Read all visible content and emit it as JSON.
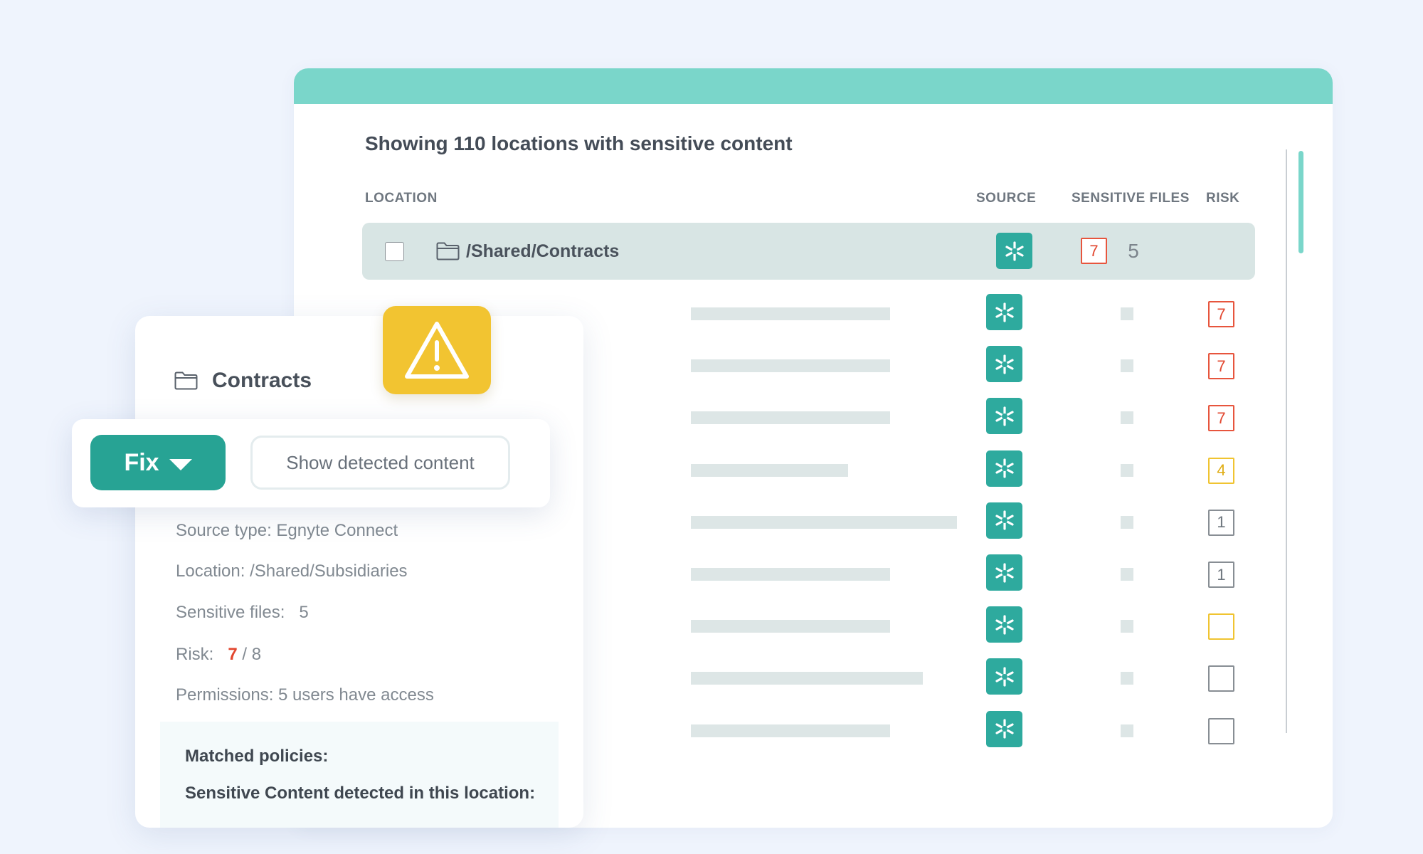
{
  "table": {
    "heading": "Showing 110 locations with sensitive content",
    "columns": {
      "location": "LOCATION",
      "source": "SOURCE",
      "sensitive_files": "SENSITIVE FILES",
      "risk": "RISK"
    },
    "selected_row": {
      "path": "/Shared/Contracts",
      "source_icon": "egnyte-connect-icon",
      "sensitive_files": "5",
      "risk": "7"
    },
    "rows": [
      {
        "risk": "7",
        "risk_level": "high"
      },
      {
        "risk": "7",
        "risk_level": "high"
      },
      {
        "risk": "7",
        "risk_level": "high"
      },
      {
        "risk": "4",
        "risk_level": "medium"
      },
      {
        "risk": "1",
        "risk_level": "low"
      },
      {
        "risk": "1",
        "risk_level": "low"
      },
      {
        "risk": "",
        "risk_level": "medium"
      },
      {
        "risk": "",
        "risk_level": "low"
      },
      {
        "risk": "",
        "risk_level": "low"
      }
    ]
  },
  "detail": {
    "title": "Contracts",
    "fix_label": "Fix",
    "show_content_label": "Show detected content",
    "source_type": "Source type: Egnyte Connect",
    "location": "Location: /Shared/Subsidiaries",
    "sensitive_files_label": "Sensitive files:",
    "sensitive_files_value": "5",
    "risk_label": "Risk:",
    "risk_value": "7",
    "risk_max": "/ 8",
    "permissions": "Permissions: 5 users have access",
    "matched_policies": "Matched policies:",
    "sensitive_content": "Sensitive Content detected in this location:"
  },
  "colors": {
    "accent_teal": "#27a394",
    "topbar_teal": "#7ad6ca",
    "risk_high": "#e2462e",
    "risk_medium": "#f0c431",
    "warning_yellow": "#f2c431"
  },
  "icons": [
    "folder-icon",
    "egnyte-connect-icon",
    "warning-icon",
    "chevron-down-icon"
  ]
}
